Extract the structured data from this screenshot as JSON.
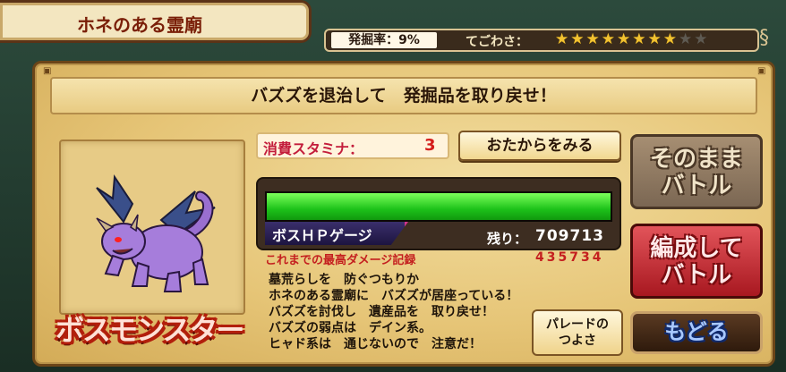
{
  "header": {
    "title": "ホネのある霊廟",
    "dig_rate": "発掘率：9%",
    "difficulty_label": "てごわさ：",
    "difficulty_stars": 8,
    "difficulty_max": 10
  },
  "mission": {
    "text": "バズズを退治して　発掘品を取り戻せ！"
  },
  "boss": {
    "label": "ボスモンスター"
  },
  "stamina": {
    "label": "消費スタミナ：",
    "value": "3"
  },
  "buttons": {
    "treasure": "おたからをみる",
    "direct_battle_line1": "そのまま",
    "direct_battle_line2": "バトル",
    "team_battle_line1": "編成して",
    "team_battle_line2": "バトル",
    "parade_line1": "パレードの",
    "parade_line2": "つよさ",
    "back": "もどる"
  },
  "gauge": {
    "label": "ボスＨＰゲージ",
    "remaining_label": "残り：",
    "remaining_value": "709713",
    "fill_fraction": 1.0,
    "record_label": "これまでの最高ダメージ記録",
    "record_value": "435734"
  },
  "description": [
    "墓荒らしを　防ぐつもりか",
    "ホネのある霊廟に　バズズが居座っている！",
    "バズズを討伐し　遺産品を　取り戻せ！",
    "バズズの弱点は　デイン系。",
    "ヒャド系は　通じないので　注意だ！"
  ],
  "colors": {
    "gauge_fill": "#1dc21a",
    "stamina_text": "#c31d3b",
    "star_on": "#f2c230",
    "star_off": "#5e5a52"
  }
}
